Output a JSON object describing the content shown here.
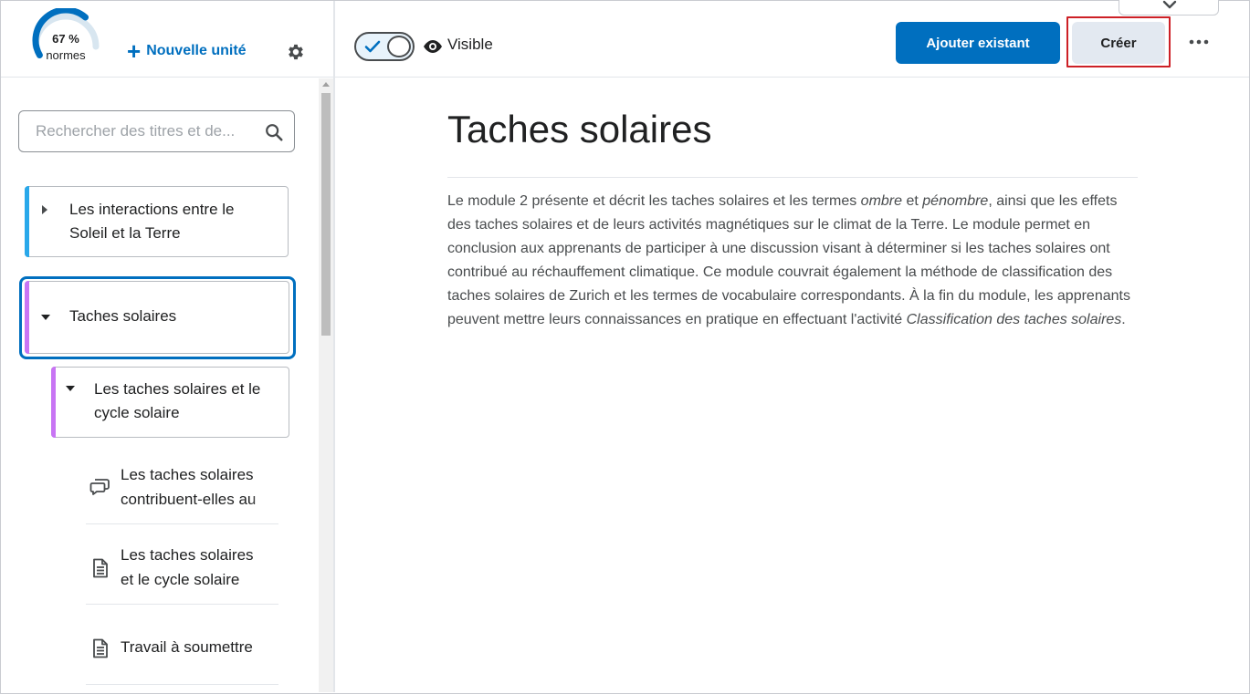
{
  "sidebar": {
    "progress": {
      "percent_text": "67 %",
      "label": "normes",
      "value": 0.67,
      "color": "#006fbf",
      "track_color": "#d8e6f0"
    },
    "new_unit_label": "Nouvelle unité",
    "settings_icon": "gear-icon",
    "search": {
      "placeholder": "Rechercher des titres et de...",
      "value": ""
    },
    "units": [
      {
        "label": "Les interactions entre le Soleil et la Terre",
        "expanded": false,
        "color": "#29a8ea"
      },
      {
        "label": "Taches solaires",
        "expanded": true,
        "selected": true,
        "color": "#c875f4"
      },
      {
        "label": "Les taches solaires et le cycle solaire",
        "expanded": true,
        "color": "#c875f4"
      }
    ],
    "topics": [
      {
        "icon": "discussion-icon",
        "line1": "Les taches solaires",
        "line2": "contribuent-elles au"
      },
      {
        "icon": "document-icon",
        "line1": "Les taches solaires",
        "line2": "et le cycle solaire"
      },
      {
        "icon": "document-icon",
        "line1": "Travail à soumettre",
        "line2": ""
      }
    ]
  },
  "toolbar": {
    "visibility_on": true,
    "visible_label": "Visible",
    "add_existing_label": "Ajouter existant",
    "create_label": "Créer",
    "more_icon": "more-horizontal-icon",
    "peek_icon": "chevron-down-icon",
    "accent": "#006fbf",
    "highlight_color": "#cd2026"
  },
  "main": {
    "title": "Taches solaires",
    "description": {
      "p1": "Le module 2 présente et décrit les taches solaires et les termes ",
      "em1": "ombre",
      "p2": " et ",
      "em2": "pénombre",
      "p3": ", ainsi que les effets des taches solaires et de leurs activités magnétiques sur le climat de la Terre. Le module permet en conclusion aux apprenants de participer à une discussion visant à déterminer si les taches solaires ont contribué au réchauffement climatique. Ce module couvrait également la méthode de classification des taches solaires de Zurich et les termes de vocabulaire correspondants. À la fin du module, les apprenants peuvent mettre leurs connaissances en pratique en effectuant l'activité ",
      "em3": "Classification des taches solaires",
      "p4": "."
    }
  }
}
